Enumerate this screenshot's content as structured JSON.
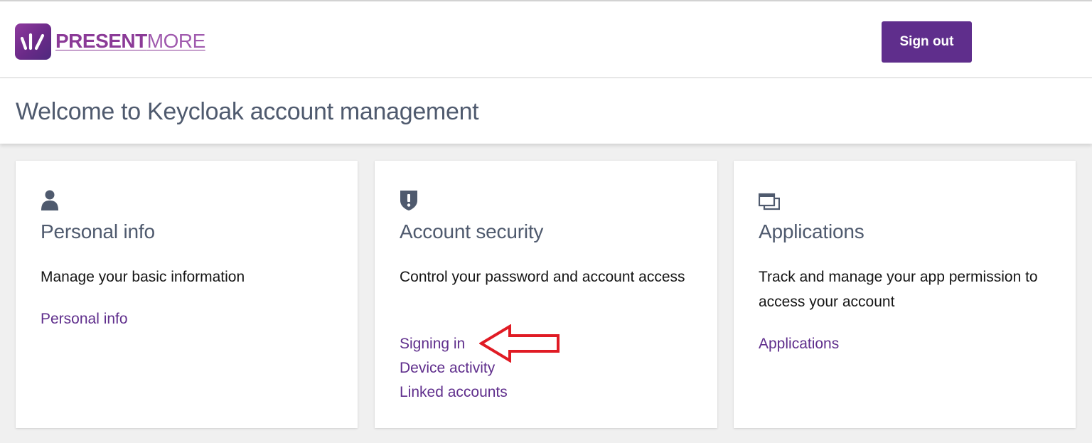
{
  "brand": {
    "name_bold": "PRESENT",
    "name_light": "MORE",
    "brand_color": "#8b3a97"
  },
  "header": {
    "signout_label": "Sign out"
  },
  "welcome": {
    "title": "Welcome to Keycloak account management"
  },
  "cards": [
    {
      "icon": "user-icon",
      "title": "Personal info",
      "description": "Manage your basic information",
      "links": [
        "Personal info"
      ]
    },
    {
      "icon": "shield-icon",
      "title": "Account security",
      "description": "Control your password and account access",
      "links": [
        "Signing in",
        "Device activity",
        "Linked accounts"
      ]
    },
    {
      "icon": "applications-icon",
      "title": "Applications",
      "description": "Track and manage your app permission to access your account",
      "links": [
        "Applications"
      ]
    }
  ],
  "colors": {
    "primary": "#5f2e8c",
    "link": "#5f2e8c",
    "heading": "#4f5a6e",
    "annotation_arrow": "#e01b24"
  },
  "annotation": {
    "icon": "red-arrow-icon",
    "points_to": "Signing in"
  }
}
